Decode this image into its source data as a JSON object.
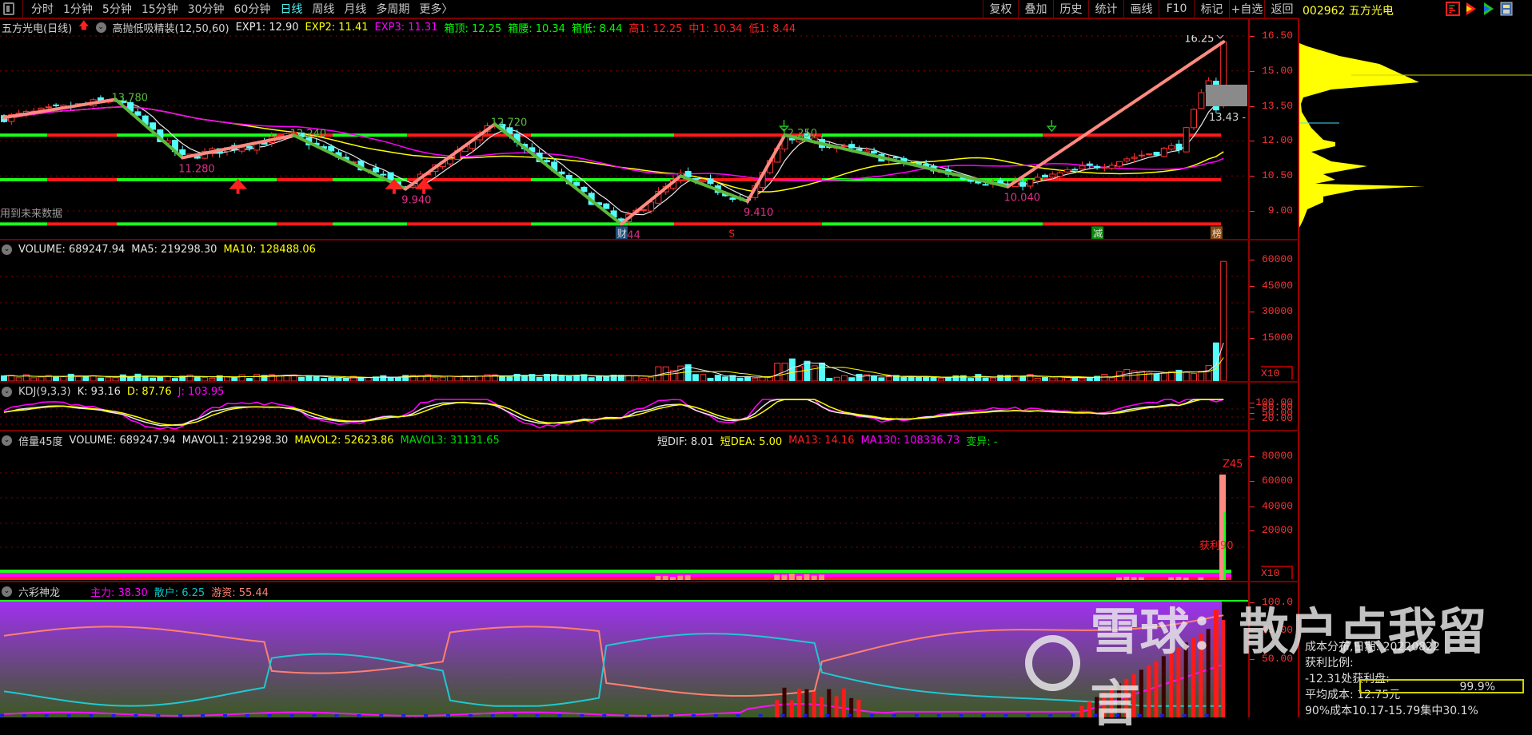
{
  "toolbar": {
    "tabs": [
      "分时",
      "1分钟",
      "5分钟",
      "15分钟",
      "30分钟",
      "60分钟",
      "日线",
      "周线",
      "月线",
      "多周期",
      "更多〉"
    ],
    "active_tab": "日线",
    "buttons": [
      "复权",
      "叠加",
      "历史",
      "统计",
      "画线",
      "F10",
      "标记",
      "+自选",
      "返回"
    ]
  },
  "stock": {
    "code_name": "002962 五方光电"
  },
  "price_panel": {
    "header": [
      {
        "text": "五方光电(日线)",
        "color": "#d0d0d0"
      },
      {
        "text": "高抛低吸精装(12,50,60)",
        "color": "#d0d0d0"
      },
      {
        "text": "EXP1: 12.90",
        "color": "#e8e8e8"
      },
      {
        "text": "EXP2: 11.41",
        "color": "#ffff00"
      },
      {
        "text": "EXP3: 11.31",
        "color": "#ff00ff"
      },
      {
        "text": "箱顶: 12.25",
        "color": "#00ff00"
      },
      {
        "text": "箱腰: 10.34",
        "color": "#00ff00"
      },
      {
        "text": "箱低: 8.44",
        "color": "#00ff00"
      },
      {
        "text": "高1: 12.25",
        "color": "#ff2020"
      },
      {
        "text": "中1: 10.34",
        "color": "#ff2020"
      },
      {
        "text": "低1: 8.44",
        "color": "#ff2020"
      }
    ],
    "axis_labels": [
      "16.50",
      "15.00",
      "13.50",
      "12.00",
      "10.50",
      "9.00"
    ],
    "axis_values": [
      16.5,
      15.0,
      13.5,
      12.0,
      10.5,
      9.0
    ],
    "box_levels": {
      "top": 12.25,
      "mid": 10.34,
      "low": 8.44
    },
    "pivots": [
      {
        "i": 0,
        "p": 13.0,
        "label": ""
      },
      {
        "i": 15,
        "p": 13.78,
        "label": "13.780"
      },
      {
        "i": 24,
        "p": 11.28,
        "label": "11.280"
      },
      {
        "i": 39,
        "p": 12.24,
        "label": "12.240"
      },
      {
        "i": 54,
        "p": 9.94,
        "label": "9.940"
      },
      {
        "i": 66,
        "p": 12.72,
        "label": "12.720"
      },
      {
        "i": 83,
        "p": 8.44,
        "label": "8.44"
      },
      {
        "i": 91,
        "p": 10.5,
        "label": ""
      },
      {
        "i": 100,
        "p": 9.41,
        "label": "9.410"
      },
      {
        "i": 105,
        "p": 12.25,
        "label": "12.250"
      },
      {
        "i": 135,
        "p": 10.04,
        "label": "10.040"
      },
      {
        "i": 164,
        "p": 16.25,
        "label": "16.25"
      }
    ],
    "last_price_label": "13.43",
    "note": "用到未来数据",
    "markers": [
      {
        "i": 83,
        "text": "财",
        "bg": "#1e4e7a"
      },
      {
        "i": 98,
        "text": "S",
        "bg": ""
      },
      {
        "i": 147,
        "text": "减",
        "bg": "#0a8a0a"
      },
      {
        "i": 163,
        "text": "榜",
        "bg": "#8a4a10"
      }
    ]
  },
  "volume_panel": {
    "header": [
      {
        "text": "VOLUME: 689247.94",
        "color": "#e0e0e0"
      },
      {
        "text": "MA5: 219298.30",
        "color": "#e0e0e0"
      },
      {
        "text": "MA10: 128488.06",
        "color": "#ffff00"
      }
    ],
    "axis_labels": [
      "60000",
      "45000",
      "30000",
      "15000"
    ],
    "unit_label": "X10"
  },
  "kdj_panel": {
    "header": [
      {
        "text": "KDJ(9,3,3)",
        "color": "#d0d0d0"
      },
      {
        "text": "K: 93.16",
        "color": "#e0e0e0"
      },
      {
        "text": "D: 87.76",
        "color": "#ffff00"
      },
      {
        "text": "J: 103.95",
        "color": "#ff00ff"
      }
    ],
    "axis_labels": [
      "100.00",
      "80.00",
      "50.00",
      "20.00"
    ]
  },
  "double_volume_panel": {
    "header": [
      {
        "text": "倍量45度",
        "color": "#d0d0d0"
      },
      {
        "text": "VOLUME: 689247.94",
        "color": "#e0e0e0"
      },
      {
        "text": "MAVOL1: 219298.30",
        "color": "#e0e0e0"
      },
      {
        "text": "MAVOL2: 52623.86",
        "color": "#ffff00"
      },
      {
        "text": "MAVOL3: 31131.65",
        "color": "#00dd00"
      }
    ],
    "header2": [
      {
        "text": "短DIF: 8.01",
        "color": "#e0e0e0"
      },
      {
        "text": "短DEA: 5.00",
        "color": "#ffff00"
      },
      {
        "text": "MA13: 14.16",
        "color": "#ff2020"
      },
      {
        "text": "MA130: 108336.73",
        "color": "#ff00ff"
      },
      {
        "text": "变异: -",
        "color": "#00dd00"
      }
    ],
    "axis_labels": [
      "80000",
      "60000",
      "40000",
      "20000"
    ],
    "unit_label": "X10",
    "signal_label": "Z45",
    "profit_label": "获利90"
  },
  "dragon_panel": {
    "header": [
      {
        "text": "六彩神龙",
        "color": "#d0d0d0"
      },
      {
        "text": "主力: 38.30",
        "color": "#ff00ff"
      },
      {
        "text": "散户: 6.25",
        "color": "#00c8c8"
      },
      {
        "text": "游资: 55.44",
        "color": "#ff8070"
      }
    ],
    "axis_labels": [
      "100.0",
      "75.00",
      "50.00"
    ]
  },
  "cost_distribution": {
    "title": "成本分布,日期: 20220822",
    "profit_ratio_label": "获利比例:",
    "profit_ratio": "99.9%",
    "profit_ratio_value": 0.999,
    "profit_line": "-12.31处获利盘:",
    "avg_cost": "平均成本: 12.75元",
    "concentration": "90%成本10.17-15.79集中30.1%"
  },
  "watermark": {
    "text": "雪球：散户点我留言"
  },
  "colors": {
    "up": "#ff3232",
    "down": "#54fcfc",
    "grid": "#8a0000",
    "zig_up": "#ff8a80",
    "zig_down": "#5cb83c",
    "box_red": "#ff1a1a",
    "box_green": "#1aff1a"
  }
}
